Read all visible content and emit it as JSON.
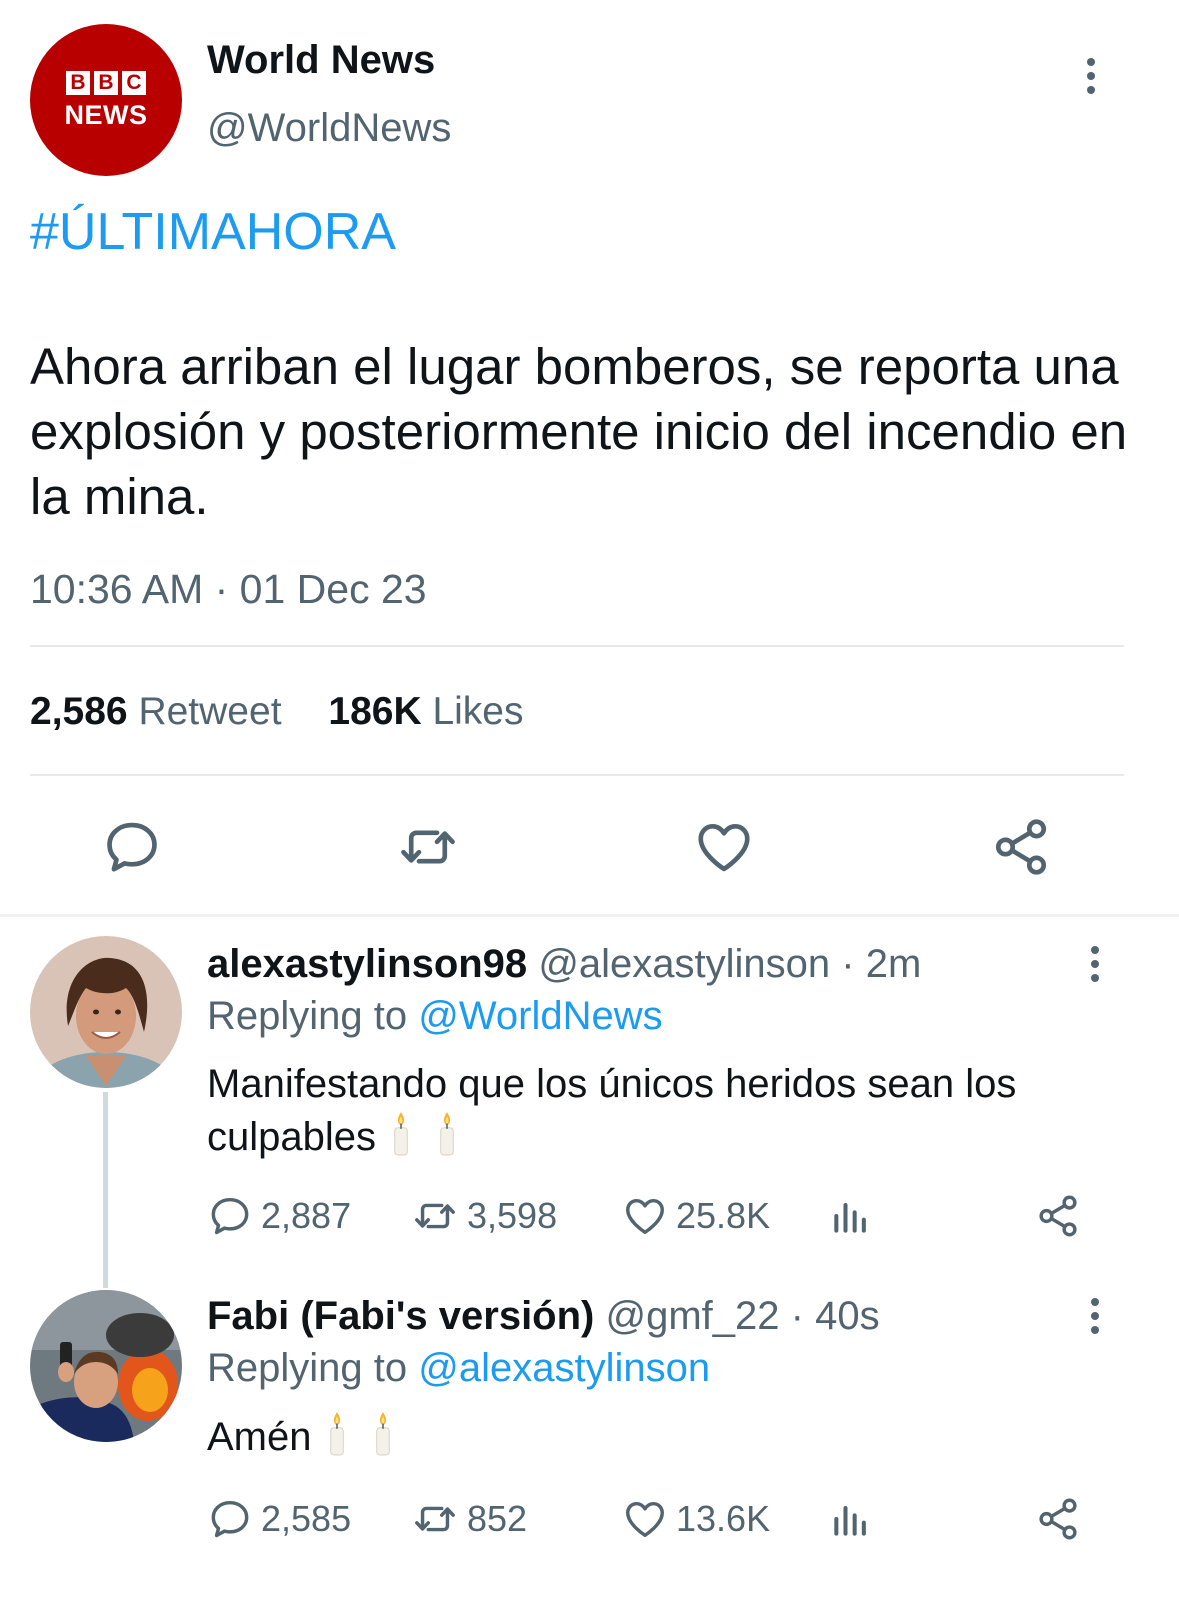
{
  "tweet": {
    "author_name": "World News",
    "author_handle": "@WorldNews",
    "avatar_logo": {
      "blocks": [
        "B",
        "B",
        "C"
      ],
      "word": "NEWS",
      "bg_color": "#b80000",
      "icon": "bbc-news-logo"
    },
    "hashtag": "#ÚLTIMAHORA",
    "text": "Ahora arriban el lugar bomberos, se reporta una explosión y posteriormente inicio del incendio en la mina.",
    "timestamp": "10:36 AM · 01 Dec 23",
    "retweets_count": "2,586",
    "retweets_label": "Retweet",
    "likes_count": "186K",
    "likes_label": "Likes"
  },
  "icons": {
    "more": "more-vertical-icon",
    "reply": "reply-icon",
    "retweet": "retweet-icon",
    "like": "heart-icon",
    "share": "share-icon",
    "views": "views-bar-chart-icon",
    "emoji": "candle-emoji"
  },
  "replies": [
    {
      "name": "alexastylinson98",
      "handle": "@alexastylinson",
      "time": "· 2m",
      "replying_prefix": "Replying to",
      "replying_to": "@WorldNews",
      "text": "Manifestando que los únicos heridos sean los culpables",
      "emoji_count": 2,
      "reply_count": "2,887",
      "retweet_count": "3,598",
      "like_count": "25.8K"
    },
    {
      "name": "Fabi (Fabi's versión)",
      "handle": "@gmf_22",
      "time": "· 40s",
      "replying_prefix": "Replying to",
      "replying_to": "@alexastylinson",
      "text": "Amén",
      "emoji_count": 2,
      "reply_count": "2,585",
      "retweet_count": "852",
      "like_count": "13.6K"
    }
  ],
  "colors": {
    "accent": "#1d9bf0",
    "secondary_text": "#536471",
    "primary_text": "#0f1419",
    "divider": "#e7e9ea",
    "bbc_red": "#b80000"
  }
}
